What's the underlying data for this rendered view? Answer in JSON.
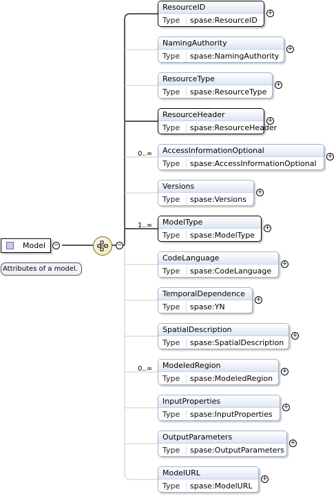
{
  "root": {
    "name": "Model",
    "annotation": "Attributes of a model."
  },
  "type_label": "Type",
  "expand_symbol": "+",
  "collapse_symbol": "−",
  "elements": [
    {
      "name": "ResourceID",
      "type": "spase:ResourceID",
      "required": true,
      "multiplicity": ""
    },
    {
      "name": "NamingAuthority",
      "type": "spase:NamingAuthority",
      "required": false,
      "multiplicity": ""
    },
    {
      "name": "ResourceType",
      "type": "spase:ResourceType",
      "required": false,
      "multiplicity": ""
    },
    {
      "name": "ResourceHeader",
      "type": "spase:ResourceHeader",
      "required": true,
      "multiplicity": ""
    },
    {
      "name": "AccessInformationOptional",
      "type": "spase:AccessInformationOptional",
      "required": false,
      "multiplicity": "0..∞"
    },
    {
      "name": "Versions",
      "type": "spase:Versions",
      "required": false,
      "multiplicity": ""
    },
    {
      "name": "ModelType",
      "type": "spase:ModelType",
      "required": true,
      "multiplicity": "1..∞"
    },
    {
      "name": "CodeLanguage",
      "type": "spase:CodeLanguage",
      "required": false,
      "multiplicity": ""
    },
    {
      "name": "TemporalDependence",
      "type": "spase:YN",
      "required": false,
      "multiplicity": ""
    },
    {
      "name": "SpatialDescription",
      "type": "spase:SpatialDescription",
      "required": false,
      "multiplicity": ""
    },
    {
      "name": "ModeledRegion",
      "type": "spase:ModeledRegion",
      "required": false,
      "multiplicity": "0..∞"
    },
    {
      "name": "InputProperties",
      "type": "spase:InputProperties",
      "required": false,
      "multiplicity": ""
    },
    {
      "name": "OutputParameters",
      "type": "spase:OutputParameters",
      "required": false,
      "multiplicity": ""
    },
    {
      "name": "ModelURL",
      "type": "spase:ModelURL",
      "required": false,
      "multiplicity": ""
    }
  ]
}
